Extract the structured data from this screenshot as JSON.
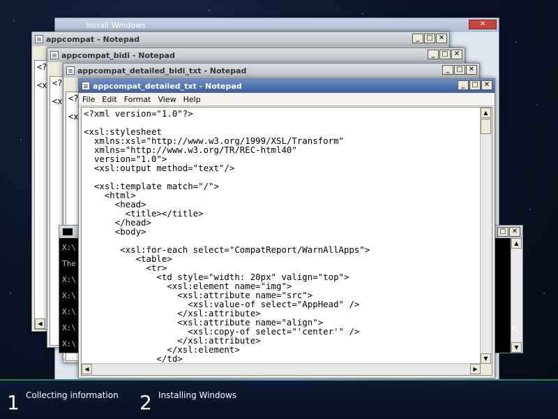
{
  "background_window": {
    "title": "Install Windows"
  },
  "notepad_windows": [
    {
      "title": "appcompat - Notepad"
    },
    {
      "title": "appcompat_bidi - Notepad"
    },
    {
      "title": "appcompat_detailed_bidi_txt - Notepad"
    }
  ],
  "ghost_lines": {
    "w1": [
      "<?",
      "<x"
    ],
    "w2": [
      "<?",
      "<x"
    ],
    "w3": [
      "<?",
      "<x"
    ]
  },
  "console": {
    "lines": [
      "X:\\",
      "The",
      "X:\\",
      "X:\\",
      "X:\\",
      "X:\\",
      "X:\\",
      "X:\\"
    ]
  },
  "main_window": {
    "title": "appcompat_detailed_txt - Notepad",
    "menu": [
      "File",
      "Edit",
      "Format",
      "View",
      "Help"
    ],
    "content": "<?xml version=\"1.0\"?>\n\n<xsl:stylesheet\n  xmlns:xsl=\"http://www.w3.org/1999/XSL/Transform\"\n  xmlns=\"http://www.w3.org/TR/REC-html40\"\n  version=\"1.0\">\n  <xsl:output method=\"text\"/>\n\n  <xsl:template match=\"/\">\n    <html>\n      <head>\n        <title></title>\n      </head>\n      <body>\n\n       <xsl:for-each select=\"CompatReport/WarnAllApps\">\n          <table>\n            <tr>\n              <td style=\"width: 20px\" valign=\"top\">\n                <xsl:element name=\"img\">\n                  <xsl:attribute name=\"src\">\n                    <xsl:value-of select=\"AppHead\" />\n                  </xsl:attribute>\n                  <xsl:attribute name=\"align\">\n                    <xsl:copy-of select=\"'center'\" />\n                  </xsl:attribute>\n                </xsl:element>\n              </td>"
  },
  "window_controls": {
    "minimize": "_",
    "maximize": "□",
    "close": "✕"
  },
  "setup_steps": [
    {
      "number": "1",
      "label": "Collecting information"
    },
    {
      "number": "2",
      "label": "Installing Windows"
    }
  ],
  "colors": {
    "active_title": "#3c5f9e",
    "inactive_title": "#c3c9d1"
  }
}
